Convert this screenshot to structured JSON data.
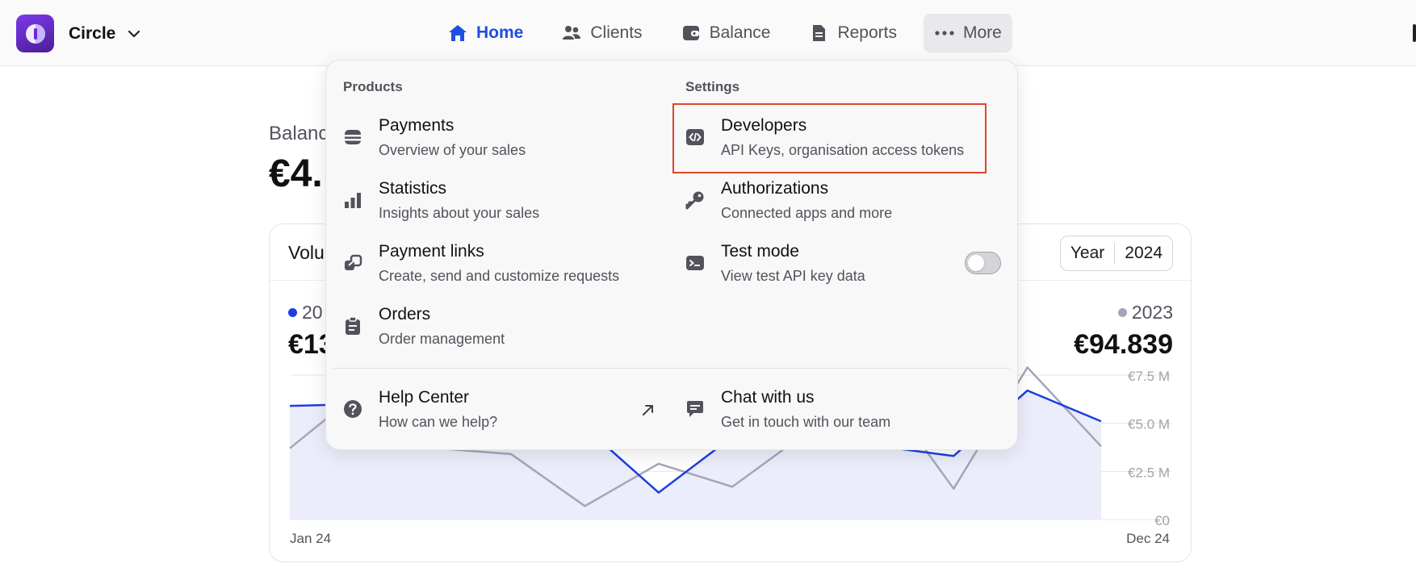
{
  "brand": {
    "name": "Circle"
  },
  "nav": [
    {
      "label": "Home",
      "icon": "home-icon",
      "active": true
    },
    {
      "label": "Clients",
      "icon": "users-icon"
    },
    {
      "label": "Balance",
      "icon": "wallet-icon"
    },
    {
      "label": "Reports",
      "icon": "document-icon"
    },
    {
      "label": "More",
      "icon": "ellipsis-icon"
    }
  ],
  "balance": {
    "label": "Balance",
    "amount": "€4."
  },
  "volume_card": {
    "title": "Volu",
    "period_select": {
      "unit": "Year",
      "value": "2024"
    },
    "current": {
      "label": "20",
      "total": "€13"
    },
    "previous": {
      "label": "2023",
      "total": "€94.839"
    }
  },
  "colors": {
    "accent": "#1f4fe0",
    "series_2024": "#1d3ee0",
    "series_2023": "#a3a6b8",
    "highlight": "#e0442a"
  },
  "menu": {
    "products_title": "Products",
    "settings_title": "Settings",
    "products": [
      {
        "title": "Payments",
        "desc": "Overview of your sales",
        "icon": "payments-icon"
      },
      {
        "title": "Statistics",
        "desc": "Insights about your sales",
        "icon": "bar-chart-icon"
      },
      {
        "title": "Payment links",
        "desc": "Create, send and customize requests",
        "icon": "link-icon"
      },
      {
        "title": "Orders",
        "desc": "Order management",
        "icon": "clipboard-icon"
      }
    ],
    "settings": [
      {
        "title": "Developers",
        "desc": "API Keys, organisation access tokens",
        "icon": "code-icon"
      },
      {
        "title": "Authorizations",
        "desc": "Connected apps and more",
        "icon": "key-icon"
      },
      {
        "title": "Test mode",
        "desc": "View test API key data",
        "icon": "terminal-icon",
        "toggle_on": false
      }
    ],
    "help": {
      "title": "Help Center",
      "desc": "How can we help?",
      "icon": "question-icon"
    },
    "chat": {
      "title": "Chat with us",
      "desc": "Get in touch with our team",
      "icon": "chat-icon"
    }
  },
  "chart_data": {
    "type": "line",
    "x_labels": [
      "Jan 24",
      "Dec 24"
    ],
    "x": [
      1,
      2,
      3,
      4,
      5,
      6,
      7,
      8,
      9,
      10,
      11,
      12
    ],
    "yticks": [
      "€0",
      "€2.5 M",
      "€5.0 M",
      "€7.5 M"
    ],
    "ylim": [
      0,
      7.5
    ],
    "grid": true,
    "series": [
      {
        "name": "2024",
        "values": [
          5.9,
          6.0,
          5.5,
          5.1,
          4.8,
          1.4,
          4.3,
          5.8,
          3.8,
          3.3,
          6.7,
          5.1
        ]
      },
      {
        "name": "2023",
        "values": [
          3.7,
          6.8,
          3.7,
          3.4,
          0.7,
          2.9,
          1.7,
          4.5,
          6.9,
          1.6,
          7.9,
          3.8
        ]
      }
    ]
  }
}
